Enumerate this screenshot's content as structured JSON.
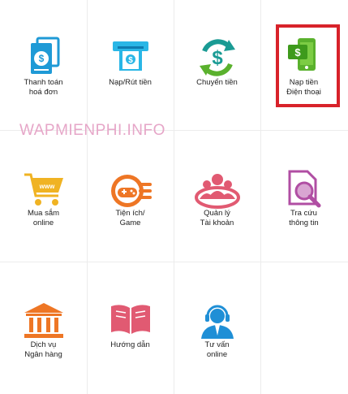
{
  "watermark": "WAPMIENPHI.INFO",
  "colors": {
    "highlight": "#d8222a",
    "blue": "#1f9ad6",
    "teal": "#1a9b94",
    "green": "#5ab12d",
    "orange": "#ee7625",
    "yellow": "#f0b323",
    "pink": "#e15a72",
    "purple": "#b04ea3"
  },
  "tiles": [
    {
      "label": "Thanh toán\nhoá đơn",
      "icon": "bill-payment-icon"
    },
    {
      "label": "Nạp/Rút tiền",
      "icon": "atm-cash-icon"
    },
    {
      "label": "Chuyển tiền",
      "icon": "money-transfer-icon"
    },
    {
      "label": "Nạp tiền\nĐiện thoại",
      "icon": "mobile-topup-icon"
    },
    {
      "label": "Mua sắm\nonline",
      "icon": "shopping-cart-icon"
    },
    {
      "label": "Tiện ích/\nGame",
      "icon": "gamepad-icon"
    },
    {
      "label": "Quản lý\nTài khoản",
      "icon": "account-users-icon"
    },
    {
      "label": "Tra cứu\nthông tin",
      "icon": "search-document-icon"
    },
    {
      "label": "Dịch vụ\nNgân hàng",
      "icon": "bank-icon"
    },
    {
      "label": "Hướng dẫn",
      "icon": "guide-book-icon"
    },
    {
      "label": "Tư vấn\nonline",
      "icon": "support-agent-icon"
    }
  ]
}
